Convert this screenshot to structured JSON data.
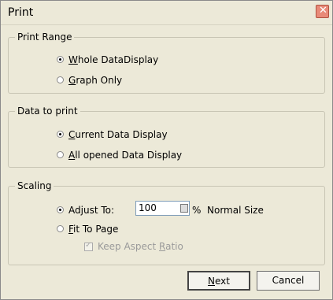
{
  "window": {
    "title": "Print",
    "close_glyph": "✕"
  },
  "groups": {
    "print_range": {
      "title": "Print Range",
      "options": [
        {
          "label_pre": "",
          "accel": "W",
          "label_post": "hole DataDisplay",
          "selected": true
        },
        {
          "label_pre": "",
          "accel": "G",
          "label_post": "raph Only",
          "selected": false
        }
      ]
    },
    "data_to_print": {
      "title": "Data to print",
      "options": [
        {
          "label_pre": "",
          "accel": "C",
          "label_post": "urrent Data Display",
          "selected": true
        },
        {
          "label_pre": "",
          "accel": "A",
          "label_post": "ll opened Data Display",
          "selected": false
        }
      ]
    },
    "scaling": {
      "title": "Scaling",
      "adjust": {
        "label_pre": "Ad",
        "accel": "j",
        "label_post": "ust To:",
        "selected": true,
        "value": "100",
        "unit": "%",
        "note": "Normal Size"
      },
      "fit": {
        "label_pre": "",
        "accel": "F",
        "label_post": "it To Page",
        "selected": false
      },
      "keep_aspect": {
        "label_pre": "Keep Aspect ",
        "accel": "R",
        "label_post": "atio",
        "checked": true,
        "enabled": false
      }
    }
  },
  "buttons": {
    "next": {
      "label_pre": "",
      "accel": "N",
      "label_post": "ext"
    },
    "cancel": {
      "label": "Cancel"
    }
  }
}
